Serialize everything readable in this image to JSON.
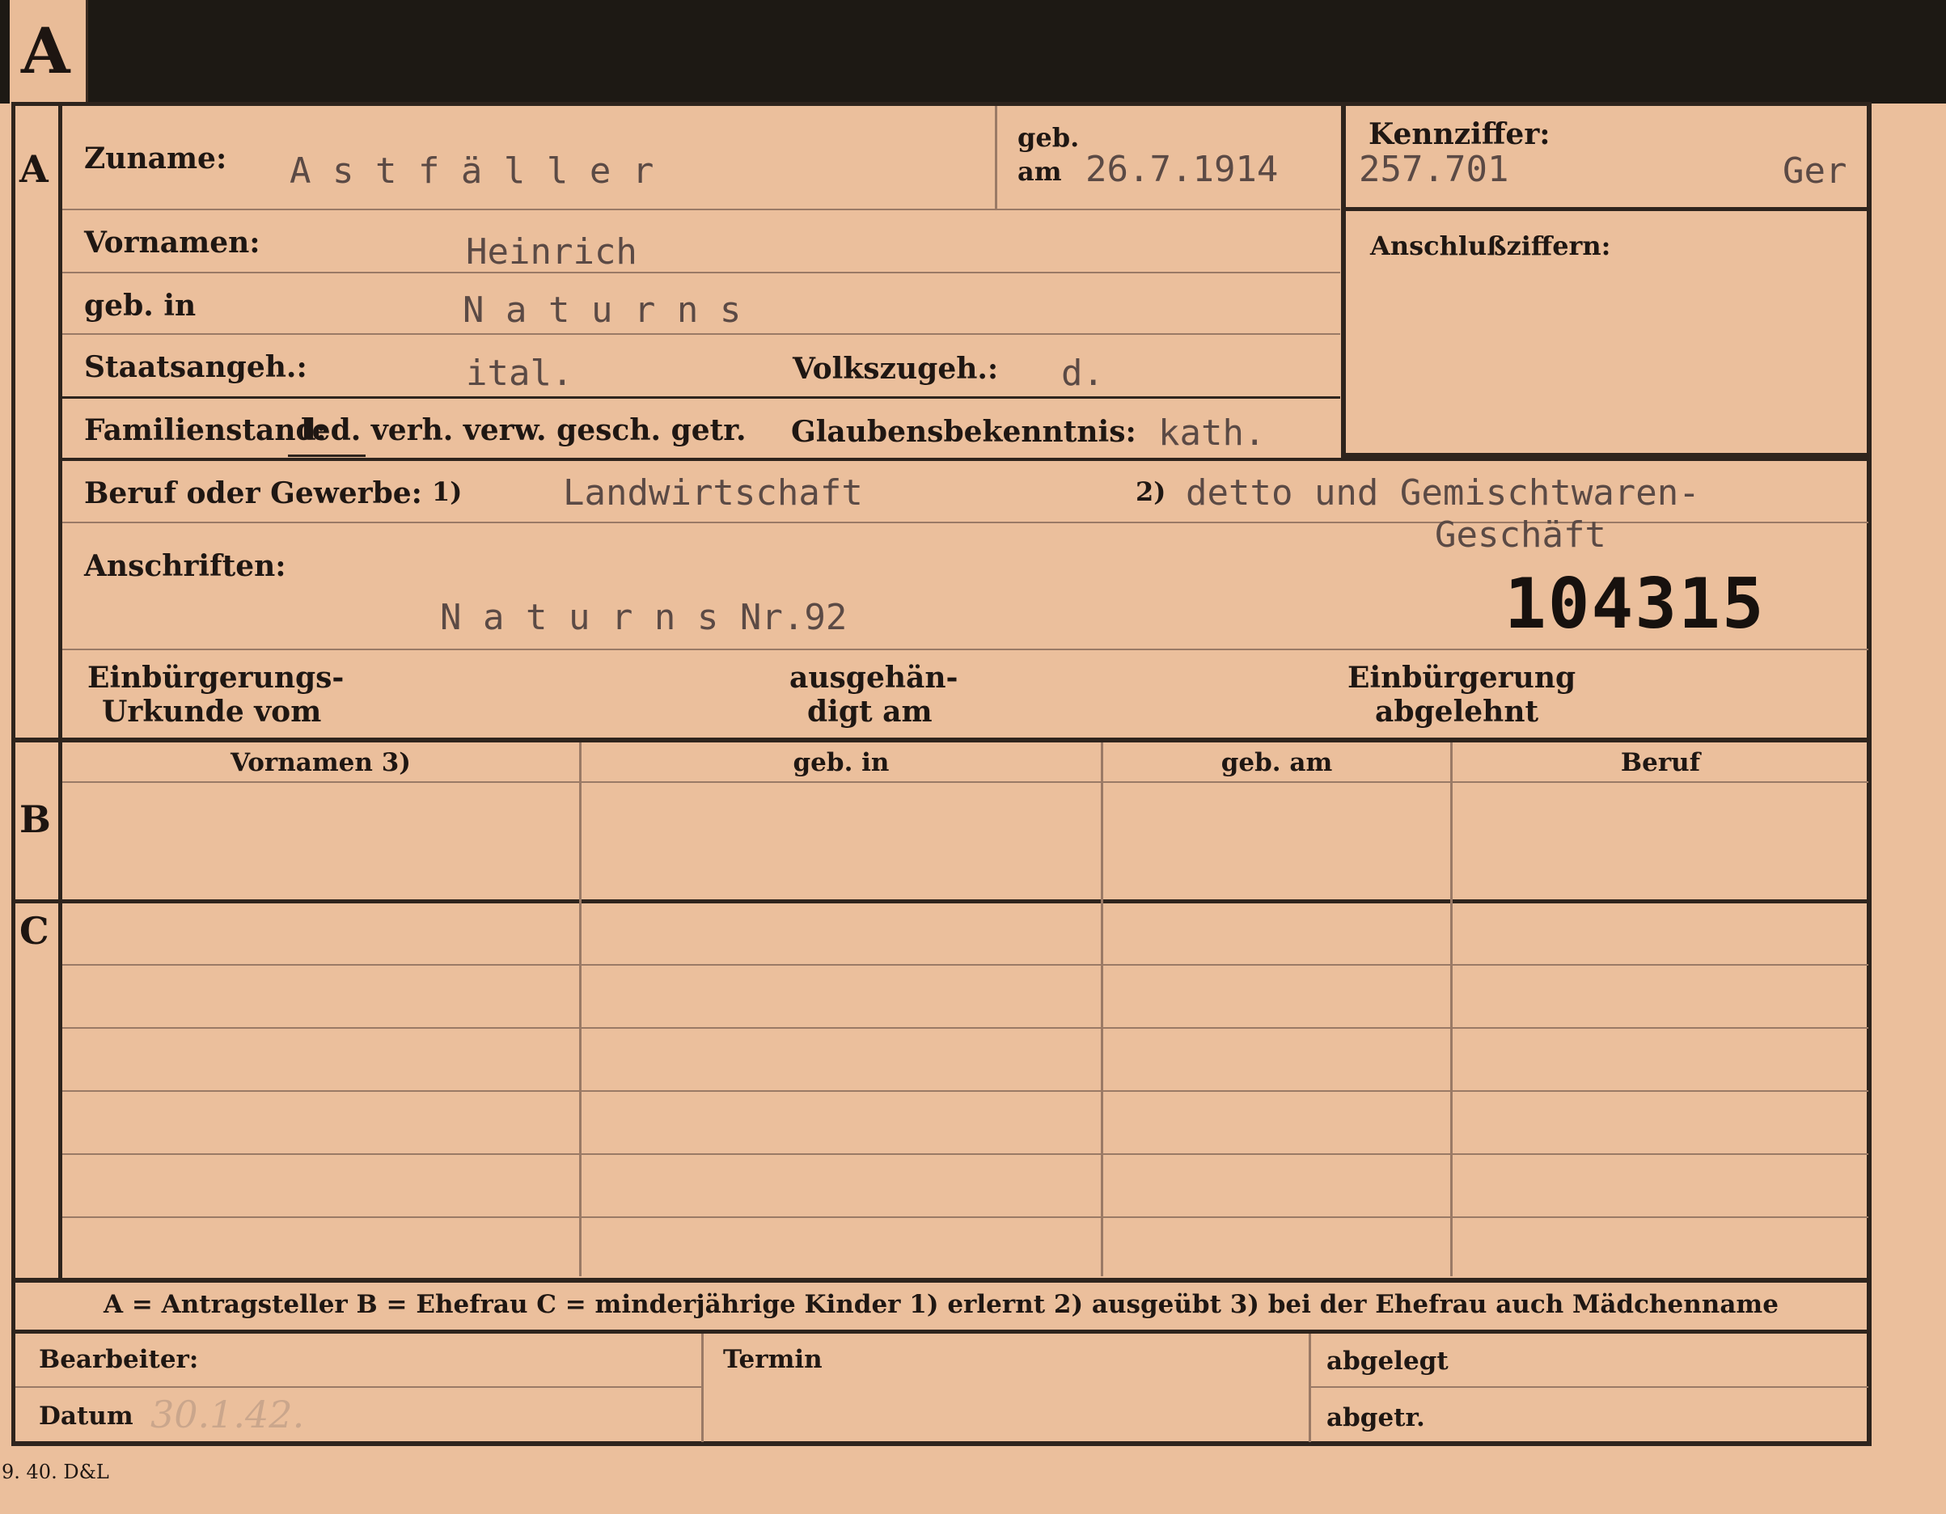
{
  "tab_letter": "A",
  "section_a": "A",
  "section_b": "B",
  "section_c": "C",
  "fields": {
    "zuname_label": "Zuname:",
    "zuname_value": "A s t f ä l l e r",
    "geb_label": "geb.",
    "am_label": "am",
    "geb_am_value": "26.7.1914",
    "kennziffer_label": "Kennziffer:",
    "kennziffer_value": "257.701",
    "kennziffer_suffix": "Ger",
    "vornamen_label": "Vornamen:",
    "vornamen_value": "Heinrich",
    "geb_in_label": "geb. in",
    "geb_in_value": "N a t u r n s",
    "anschlussziffern_label": "Anschlußziffern:",
    "staatsangeh_label": "Staatsangeh.:",
    "staatsangeh_value": "ital.",
    "volkszugeh_label": "Volkszugeh.:",
    "volkszugeh_value": "d.",
    "familienstand_label": "Familienstand:",
    "familienstand_options": "led. verh. verw. gesch. getr.",
    "glaubens_label": "Glaubensbekenntnis:",
    "glaubens_value": "kath.",
    "beruf_label": "Beruf oder Gewerbe:",
    "beruf_note1": "1)",
    "beruf_value1": "Landwirtschaft",
    "beruf_note2": "2)",
    "beruf_value2_line1": "detto und Gemischtwaren-",
    "beruf_value2_line2": "Geschäft",
    "anschriften_label": "Anschriften:",
    "anschriften_value": "N a t u r n s Nr.92",
    "stamp_number": "104315",
    "einbuergerung_label1": "Einbürgerungs-",
    "einbuergerung_label2": "Urkunde vom",
    "ausgehaendigt_label1": "ausgehän-",
    "ausgehaendigt_label2": "digt am",
    "abgelehnt_label1": "Einbürgerung",
    "abgelehnt_label2": "abgelehnt"
  },
  "table_headers": [
    "Vornamen 3)",
    "geb. in",
    "geb. am",
    "Beruf"
  ],
  "legend": "A = Antragsteller    B = Ehefrau    C = minderjährige Kinder    1) erlernt    2) ausgeübt    3) bei der Ehefrau auch Mädchenname",
  "footer": {
    "bearbeiter_label": "Bearbeiter:",
    "datum_label": "Datum",
    "datum_value": "30.1.42.",
    "termin_label": "Termin",
    "abgelegt_label": "abgelegt",
    "abgetr_label": "abgetr."
  },
  "print_code": "9. 40. D&L"
}
